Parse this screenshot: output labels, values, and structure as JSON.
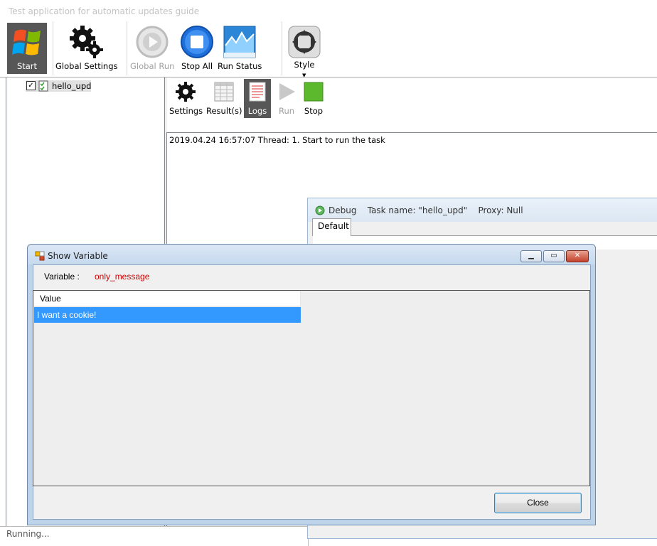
{
  "window": {
    "title": "Test application for automatic updates guide"
  },
  "toolbar": {
    "start_label": "Start",
    "global_settings_label": "Global Settings",
    "global_run_label": "Global Run",
    "stop_all_label": "Stop All",
    "run_status_label": "Run Status",
    "style_label": "Style"
  },
  "tree": {
    "items": [
      {
        "label": "hello_upd",
        "checked": true
      }
    ]
  },
  "task_toolbar": {
    "settings_label": "Settings",
    "results_label": "Result(s)",
    "logs_label": "Logs",
    "run_label": "Run",
    "stop_label": "Stop"
  },
  "log": {
    "lines": [
      "2019.04.24 16:57:07  Thread: 1.  Start to run the task"
    ]
  },
  "status_bar": {
    "text": "Running..."
  },
  "debug_window": {
    "title": "Debug    Task name: \"hello_upd\"    Proxy: Null",
    "tab_label": "Default"
  },
  "show_variable_dialog": {
    "title": "Show Variable",
    "variable_label": "Variable :",
    "variable_name": "only_message",
    "column_header": "Value",
    "rows": [
      "I want a cookie!"
    ],
    "close_button_label": "Close"
  },
  "colors": {
    "selection": "#3399ff",
    "variable_name": "#cc0000",
    "close_caption": "#c4422c"
  }
}
